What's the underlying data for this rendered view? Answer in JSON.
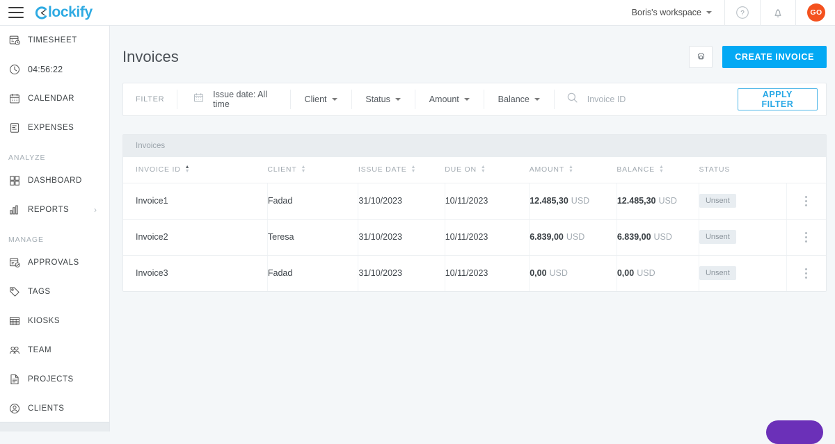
{
  "topbar": {
    "menu_icon": "hamburger-icon",
    "brand": "lockify",
    "workspace": "Boris's workspace",
    "help_icon": "help-circle-icon",
    "bell_icon": "notification-bell-icon",
    "avatar_initials": "GO"
  },
  "sidebar": {
    "items": [
      {
        "label": "TIMESHEET",
        "icon": "timesheet-icon"
      },
      {
        "label": "04:56:22",
        "icon": "clock-icon"
      },
      {
        "label": "CALENDAR",
        "icon": "calendar-icon"
      },
      {
        "label": "EXPENSES",
        "icon": "expenses-icon"
      }
    ],
    "group_analyze": "ANALYZE",
    "analyze_items": [
      {
        "label": "DASHBOARD",
        "icon": "dashboard-grid-icon"
      },
      {
        "label": "REPORTS",
        "icon": "bar-chart-icon",
        "chevron": "chevron-right-icon"
      }
    ],
    "group_manage": "MANAGE",
    "manage_items": [
      {
        "label": "APPROVALS",
        "icon": "approvals-icon"
      },
      {
        "label": "TAGS",
        "icon": "tag-icon"
      },
      {
        "label": "KIOSKS",
        "icon": "kiosk-grid-icon"
      },
      {
        "label": "TEAM",
        "icon": "team-icon"
      },
      {
        "label": "PROJECTS",
        "icon": "projects-document-icon"
      },
      {
        "label": "CLIENTS",
        "icon": "client-person-icon"
      }
    ]
  },
  "page": {
    "title": "Invoices",
    "settings_icon": "gear-icon",
    "create_button": "CREATE INVOICE"
  },
  "filter": {
    "label": "FILTER",
    "calendar_icon": "calendar-icon",
    "date_text": "Issue date: All time",
    "dropdowns": [
      "Client",
      "Status",
      "Amount",
      "Balance"
    ],
    "search_icon": "search-icon",
    "search_value": "",
    "search_placeholder": "Invoice ID",
    "apply_button": "APPLY FILTER"
  },
  "table": {
    "caption": "Invoices",
    "columns": [
      {
        "label": "INVOICE ID",
        "sortable": true,
        "sorted": "asc"
      },
      {
        "label": "CLIENT",
        "sortable": true
      },
      {
        "label": "ISSUE DATE",
        "sortable": true
      },
      {
        "label": "DUE ON",
        "sortable": true
      },
      {
        "label": "AMOUNT",
        "sortable": true
      },
      {
        "label": "BALANCE",
        "sortable": true
      },
      {
        "label": "STATUS",
        "sortable": false
      }
    ],
    "rows": [
      {
        "invoice_id": "Invoice1",
        "client": "Fadad",
        "issue_date": "31/10/2023",
        "due_on": "10/11/2023",
        "amount": "12.485,30",
        "amount_currency": "USD",
        "balance": "12.485,30",
        "balance_currency": "USD",
        "status": "Unsent",
        "menu_icon": "more-vertical-icon"
      },
      {
        "invoice_id": "Invoice2",
        "client": "Teresa",
        "issue_date": "31/10/2023",
        "due_on": "10/11/2023",
        "amount": "6.839,00",
        "amount_currency": "USD",
        "balance": "6.839,00",
        "balance_currency": "USD",
        "status": "Unsent",
        "menu_icon": "more-vertical-icon"
      },
      {
        "invoice_id": "Invoice3",
        "client": "Fadad",
        "issue_date": "31/10/2023",
        "due_on": "10/11/2023",
        "amount": "0,00",
        "amount_currency": "USD",
        "balance": "0,00",
        "balance_currency": "USD",
        "status": "Unsent",
        "menu_icon": "more-vertical-icon"
      }
    ]
  },
  "colors": {
    "brand": "#2eaae2",
    "primary_button": "#03a9f4",
    "avatar": "#f4511e",
    "fab": "#6b30b8",
    "page_bg": "#f4f7f9"
  }
}
